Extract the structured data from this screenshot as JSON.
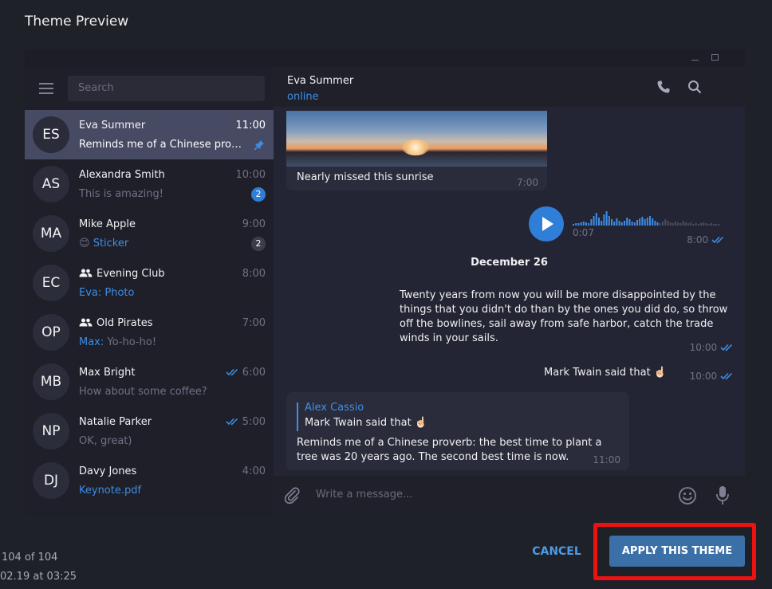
{
  "dialog": {
    "title": "Theme Preview",
    "counter": "104 of 104",
    "date": "02.19 at 03:25",
    "cancel_label": "CANCEL",
    "apply_label": "APPLY THIS THEME"
  },
  "sidebar": {
    "search_placeholder": "Search",
    "chats": [
      {
        "initials": "ES",
        "name": "Eva Summer",
        "time": "11:00",
        "preview": "Reminds me of a Chinese proverb: the best time to plant a tree",
        "pinned": true
      },
      {
        "initials": "AS",
        "name": "Alexandra Smith",
        "time": "10:00",
        "preview": "This is amazing!",
        "badge": "2"
      },
      {
        "initials": "MA",
        "name": "Mike Apple",
        "time": "9:00",
        "emoji": "😊",
        "preview": "Sticker",
        "badge": "2"
      },
      {
        "initials": "EC",
        "name": "Evening Club",
        "time": "8:00",
        "preview": "Eva: Photo",
        "group": true
      },
      {
        "initials": "OP",
        "name": "Old Pirates",
        "time": "7:00",
        "sender": "Max:",
        "preview": "Yo-ho-ho!",
        "group": true
      },
      {
        "initials": "MB",
        "name": "Max Bright",
        "time": "6:00",
        "preview": "How about some coffee?",
        "read": true
      },
      {
        "initials": "NP",
        "name": "Natalie Parker",
        "time": "5:00",
        "preview": "OK, great)",
        "read": true
      },
      {
        "initials": "DJ",
        "name": "Davy Jones",
        "time": "4:00",
        "preview": "Keynote.pdf"
      }
    ]
  },
  "chat": {
    "peer_name": "Eva Summer",
    "peer_status": "online",
    "photo_caption": "Nearly missed this sunrise",
    "photo_time": "7:00",
    "voice_duration": "0:07",
    "voice_time": "8:00",
    "date_separator": "December 26",
    "quote_text": "Twenty years from now you will be more disappointed by the things that you didn't do than by the ones you did do, so throw off the bowlines, sail away from safe harbor, catch the trade winds in your sails.",
    "quote_time": "10:00",
    "twain_text": "Mark Twain said that ☝🏻",
    "twain_time": "10:00",
    "reply_name": "Alex Cassio",
    "reply_quoted": "Mark Twain said that ☝🏻",
    "reply_body": "Reminds me of a Chinese proverb: the best time to plant a tree was 20 years ago. The second best time is now.",
    "reply_time": "11:00",
    "composer_placeholder": "Write a message..."
  },
  "colors": {
    "accent": "#2f7ed8",
    "link": "#3d8ee5",
    "highlight_box": "#ee1111",
    "apply_button": "#3a6fa8"
  }
}
